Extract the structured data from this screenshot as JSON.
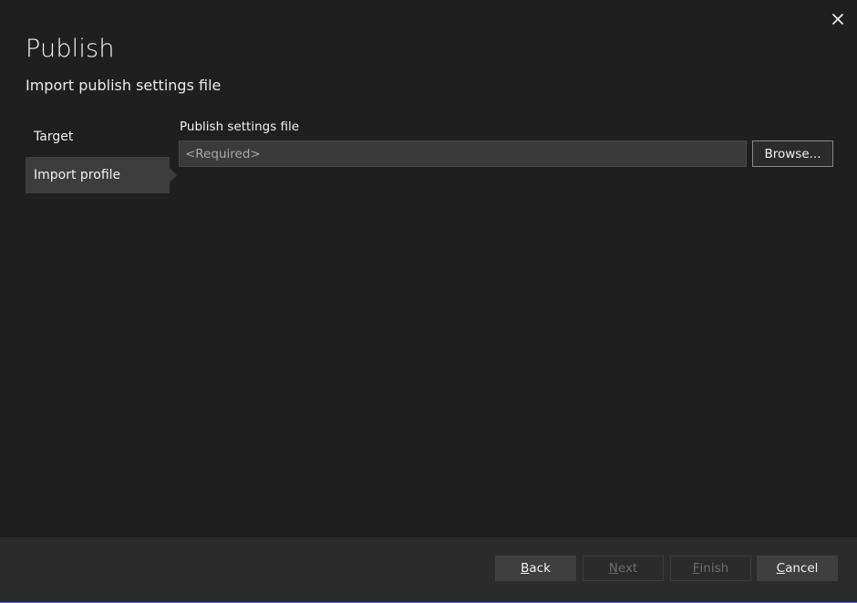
{
  "window": {
    "title": "Publish",
    "subtitle": "Import publish settings file"
  },
  "steps": [
    {
      "label": "Target",
      "active": false
    },
    {
      "label": "Import profile",
      "active": true
    }
  ],
  "form": {
    "field_label": "Publish settings file",
    "field_value": "",
    "field_placeholder": "<Required>",
    "browse_label": "Browse..."
  },
  "footer": {
    "back": {
      "accel": "B",
      "rest": "ack",
      "enabled": true
    },
    "next": {
      "accel": "N",
      "rest": "ext",
      "enabled": false
    },
    "finish": {
      "accel": "F",
      "rest": "inish",
      "enabled": false
    },
    "cancel": {
      "accel": "C",
      "rest": "ancel",
      "enabled": true
    }
  },
  "icons": {
    "close": "close-icon"
  },
  "colors": {
    "background": "#1f1f1f",
    "footer_background": "#2b2b2b",
    "active_step": "#3d3d3d",
    "accent_border": "#6b5fd6"
  }
}
